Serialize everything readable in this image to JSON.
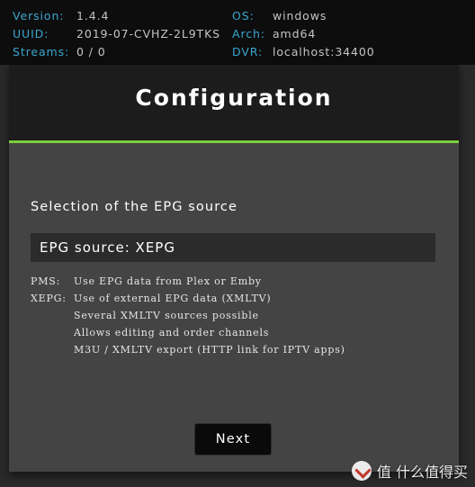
{
  "status": {
    "version": {
      "label": "Version:",
      "value": "1.4.4"
    },
    "os": {
      "label": "OS:",
      "value": "windows"
    },
    "uuid": {
      "label": "UUID:",
      "value": "2019-07-CVHZ-2L9TKS"
    },
    "arch": {
      "label": "Arch:",
      "value": "amd64"
    },
    "streams": {
      "label": "Streams:",
      "value": "0 / 0"
    },
    "dvr": {
      "label": "DVR:",
      "value": "localhost:34400"
    }
  },
  "panel": {
    "title": "Configuration",
    "section_heading": "Selection of the EPG source",
    "epg_source_display": "EPG source: XEPG",
    "descriptions": [
      {
        "key": "PMS:",
        "text": "Use EPG data from Plex or Emby"
      },
      {
        "key": "XEPG:",
        "text": "Use of external EPG data (XMLTV)"
      },
      {
        "key": "",
        "text": "Several XMLTV sources possible"
      },
      {
        "key": "",
        "text": "Allows editing and order channels"
      },
      {
        "key": "",
        "text": "M3U / XMLTV export (HTTP link for IPTV apps)"
      }
    ],
    "next_label": "Next"
  },
  "watermark": {
    "text": "值 什么值得买",
    "icon": "zhi-logo-icon"
  },
  "colors": {
    "accent_green": "#7ccf3c",
    "status_label": "#3aa6cf",
    "panel_bg": "#444444",
    "header_bg": "#1c1c1c"
  }
}
